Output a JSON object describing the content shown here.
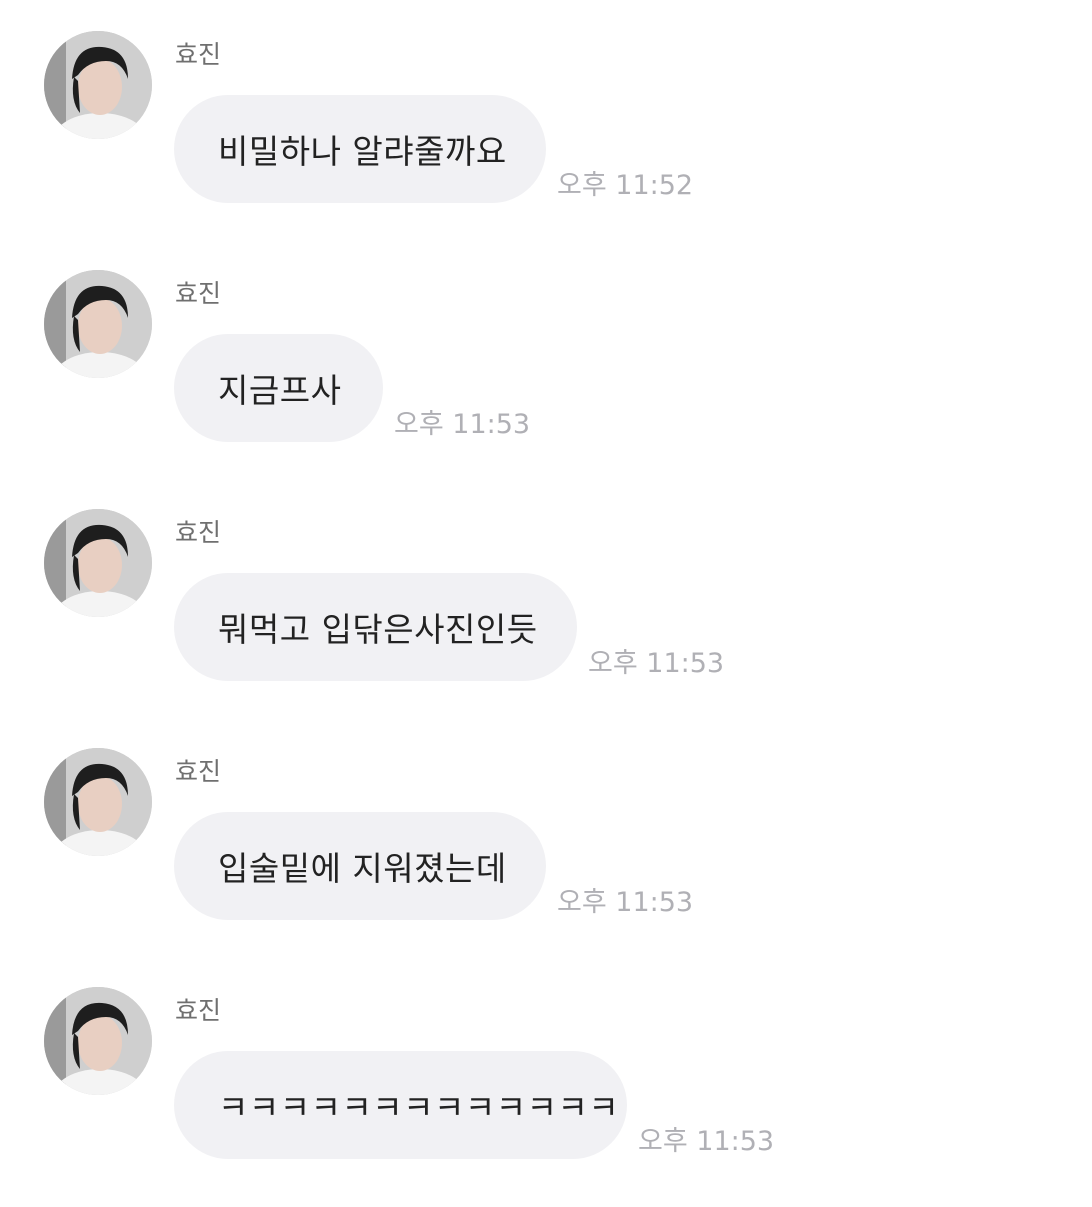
{
  "messages": [
    {
      "sender": "효진",
      "text": "비밀하나 알랴줄까요",
      "time": "오후 11:52"
    },
    {
      "sender": "효진",
      "text": "지금프사",
      "time": "오후 11:53"
    },
    {
      "sender": "효진",
      "text": "뭐먹고 입닦은사진인듯",
      "time": "오후 11:53"
    },
    {
      "sender": "효진",
      "text": "입술밑에 지워졌는데",
      "time": "오후 11:53"
    },
    {
      "sender": "효진",
      "text": "ㅋㅋㅋㅋㅋㅋㅋㅋㅋㅋㅋㅋㅋ",
      "time": "오후 11:53"
    }
  ],
  "colors": {
    "bubble": "#f1f1f4",
    "message_text": "#222222",
    "sender_text": "#6f6f6f",
    "timestamp_text": "#b0b0b5",
    "background": "#ffffff"
  },
  "icons": {
    "avatar": "profile-photo-avatar"
  }
}
